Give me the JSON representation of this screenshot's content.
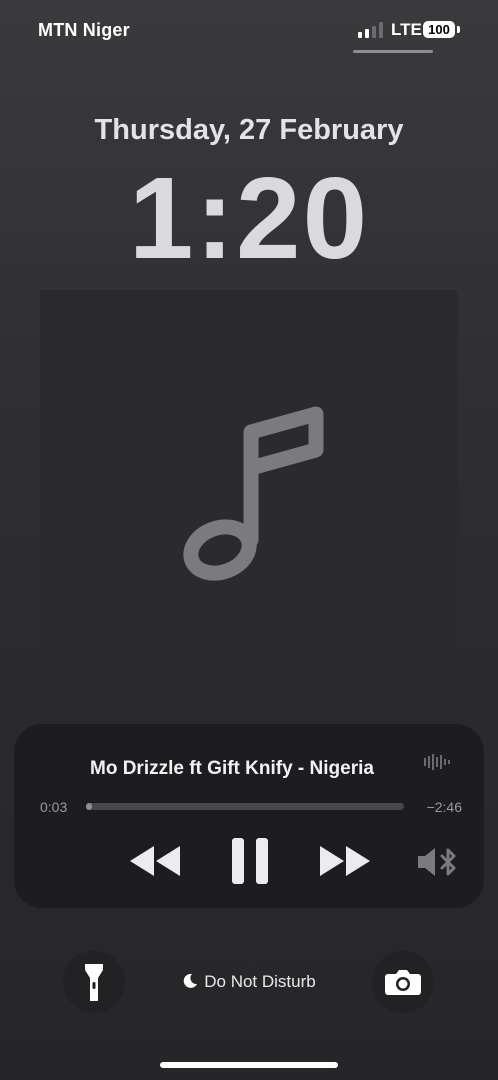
{
  "status": {
    "carrier": "MTN Niger",
    "network": "LTE",
    "battery": "100"
  },
  "lockscreen": {
    "date": "Thursday, 27 February",
    "time": "1:20"
  },
  "now_playing": {
    "title": "Mo Drizzle ft Gift Knify - Nigeria",
    "elapsed": "0:03",
    "remaining": "−2:46",
    "progress": 0.02,
    "artwork_icon": "music-note-icon"
  },
  "bottom": {
    "focus_label": "Do Not Disturb",
    "focus_icon": "moon-icon",
    "left_icon": "flashlight-icon",
    "right_icon": "camera-icon"
  },
  "colors": {
    "player_bg": "#1d1d1f",
    "accent_gray": "#8d8d90"
  }
}
